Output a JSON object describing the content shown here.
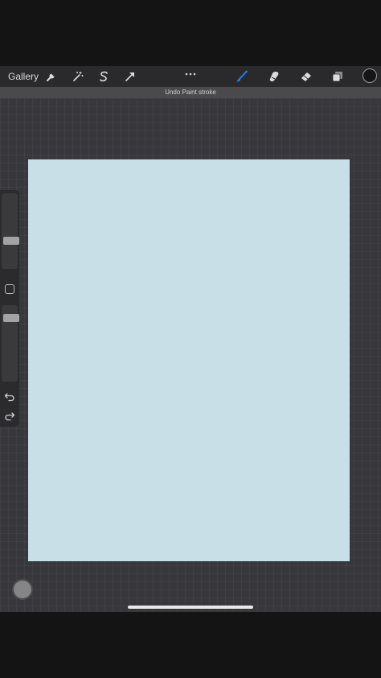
{
  "toolbar": {
    "gallery_label": "Gallery",
    "left_tools": [
      "wrench-icon",
      "magic-wand-icon",
      "selection-s-icon",
      "transform-arrow-icon"
    ],
    "right_tools": [
      "brush-icon",
      "smudge-icon",
      "eraser-icon",
      "layers-icon"
    ],
    "active_tool": "brush-icon",
    "active_color": "#151515",
    "accent": "#1e7cf2"
  },
  "banner": {
    "text": "Undo Paint stroke"
  },
  "canvas": {
    "fill": "#c8dfe8"
  },
  "sidebar": {
    "brush_size": 0.35,
    "opacity": 0.9
  }
}
